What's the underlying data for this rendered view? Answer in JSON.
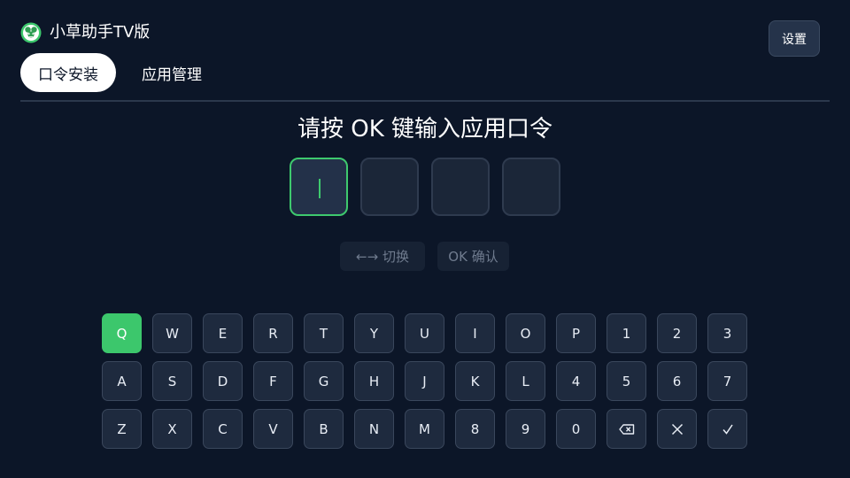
{
  "header": {
    "app_title": "小草助手TV版",
    "settings_label": "设置",
    "logo_icon": "clover-logo-icon"
  },
  "tabs": [
    {
      "label": "口令安装",
      "active": true
    },
    {
      "label": "应用管理",
      "active": false
    }
  ],
  "main": {
    "prompt": "请按 OK 键输入应用口令",
    "code_length": 4,
    "code_value": "",
    "hints": [
      {
        "label": "←→ 切换"
      },
      {
        "label": "OK 确认"
      }
    ]
  },
  "keyboard": {
    "rows": [
      [
        "Q",
        "W",
        "E",
        "R",
        "T",
        "Y",
        "U",
        "I",
        "O",
        "P",
        "1",
        "2",
        "3"
      ],
      [
        "A",
        "S",
        "D",
        "F",
        "G",
        "H",
        "J",
        "K",
        "L",
        "4",
        "5",
        "6",
        "7"
      ],
      [
        "Z",
        "X",
        "C",
        "V",
        "B",
        "N",
        "M",
        "8",
        "9",
        "0",
        "backspace-icon",
        "clear-icon",
        "confirm-icon"
      ]
    ],
    "focused_key": "Q"
  },
  "colors": {
    "background": "#0c1628",
    "accent_green": "#3cc76c",
    "key_bg": "#1e2a3e",
    "key_border": "#3a475c",
    "hint_text": "#6f7b8e"
  }
}
